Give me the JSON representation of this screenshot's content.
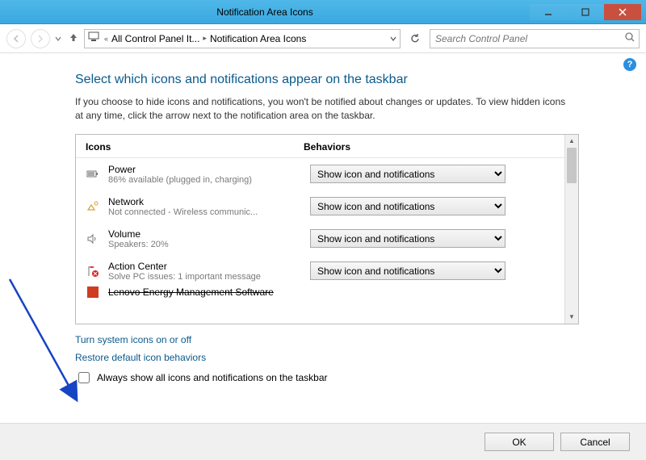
{
  "window": {
    "title": "Notification Area Icons"
  },
  "breadcrumb": {
    "root_icon": "monitor-icon",
    "part1": "All Control Panel It...",
    "part2": "Notification Area Icons"
  },
  "search": {
    "placeholder": "Search Control Panel"
  },
  "page": {
    "heading": "Select which icons and notifications appear on the taskbar",
    "description": "If you choose to hide icons and notifications, you won't be notified about changes or updates. To view hidden icons at any time, click the arrow next to the notification area on the taskbar.",
    "col_icons": "Icons",
    "col_behaviors": "Behaviors"
  },
  "dropdown_option": "Show icon and notifications",
  "items": [
    {
      "name": "Power",
      "sub": "86% available (plugged in, charging)",
      "icon": "battery-icon"
    },
    {
      "name": "Network",
      "sub": "Not connected - Wireless communic...",
      "icon": "network-icon"
    },
    {
      "name": "Volume",
      "sub": "Speakers: 20%",
      "icon": "speaker-icon"
    },
    {
      "name": "Action Center",
      "sub": "Solve PC issues: 1 important message",
      "icon": "flag-icon"
    },
    {
      "name": "Lenovo Energy Management Software",
      "sub": "",
      "icon": "app-icon"
    }
  ],
  "links": {
    "turn": "Turn system icons on or off",
    "restore": "Restore default icon behaviors"
  },
  "checkbox": {
    "label": "Always show all icons and notifications on the taskbar",
    "checked": false
  },
  "buttons": {
    "ok": "OK",
    "cancel": "Cancel"
  }
}
